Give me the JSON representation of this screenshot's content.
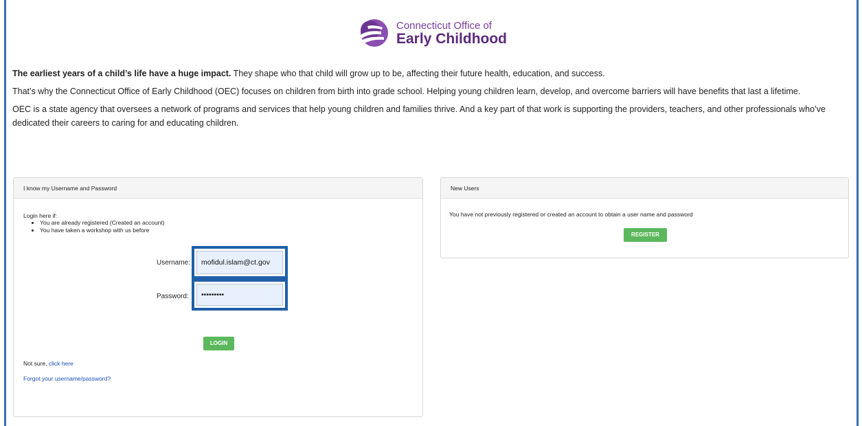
{
  "logo": {
    "line1": "Connecticut Office of",
    "line2": "Early Childhood"
  },
  "intro": {
    "p1_bold": "The earliest years of a child’s life have a huge impact.",
    "p1_rest": " They shape who that child will grow up to be, affecting their future health, education, and success.",
    "p2": "That’s why the Connecticut Office of Early Childhood (OEC) focuses on children from birth into grade school. Helping young children learn, develop, and overcome barriers will have benefits that last a lifetime.",
    "p3": "OEC is a state agency that oversees a network of programs and services that help young children and families thrive. And a key part of that work is supporting the providers, teachers, and other professionals who’ve dedicated their careers to caring for and educating children."
  },
  "login_panel": {
    "heading": "I know my Username and Password",
    "intro": "Login here if:",
    "bullets": [
      "You are already registered (Created an account)",
      "You have taken a workshop with us before"
    ],
    "username_label": "Username:",
    "username_value": "mofidul.islam@ct.gov",
    "password_label": "Password:",
    "password_value": "•••••••••",
    "login_button": "LOGIN",
    "not_sure_prefix": "Not sure, ",
    "not_sure_link": "click here",
    "forgot_link": "Forgot your username/password?"
  },
  "new_users_panel": {
    "heading": "New Users",
    "message": "You have not previously registered or created an account to obtain a user name and password",
    "register_button": "REGISTER"
  },
  "colors": {
    "accent_border": "#1f5fa8",
    "button_green": "#5cb85c",
    "logo_purple": "#7a3b9a",
    "link_blue": "#1a4fb5"
  }
}
